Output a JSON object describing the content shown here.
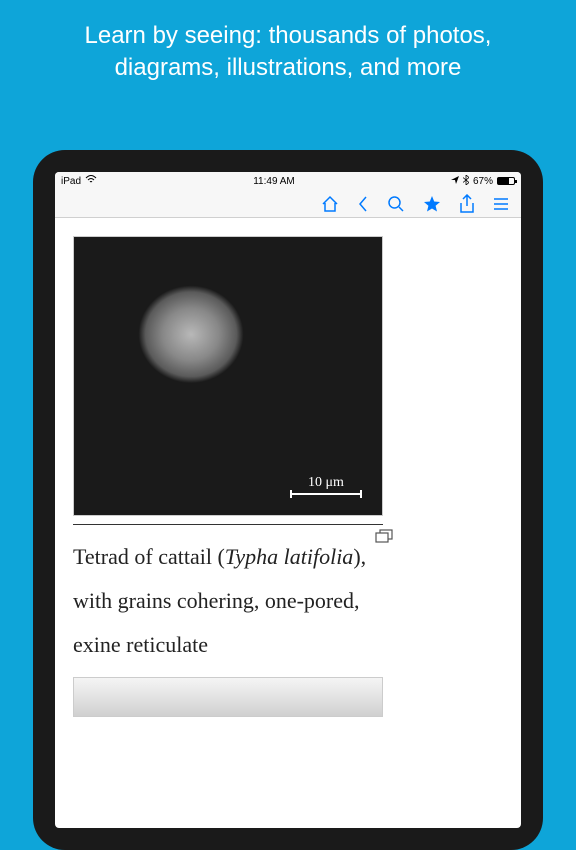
{
  "promo": {
    "text": "Learn by seeing: thousands of photos, diagrams, illustrations, and more"
  },
  "statusbar": {
    "carrier": "iPad",
    "time": "11:49 AM",
    "battery_pct": "67%"
  },
  "toolbar": {
    "icons": {
      "home": "home-icon",
      "back": "back-icon",
      "search": "search-icon",
      "star": "star-icon",
      "share": "share-icon",
      "menu": "menu-icon"
    }
  },
  "content": {
    "scale_label": "10 μm",
    "caption_pre": "Tetrad of cattail (",
    "caption_species": "Typha latifolia",
    "caption_post": "), with grains cohering, one-pored, exine reticulate"
  }
}
